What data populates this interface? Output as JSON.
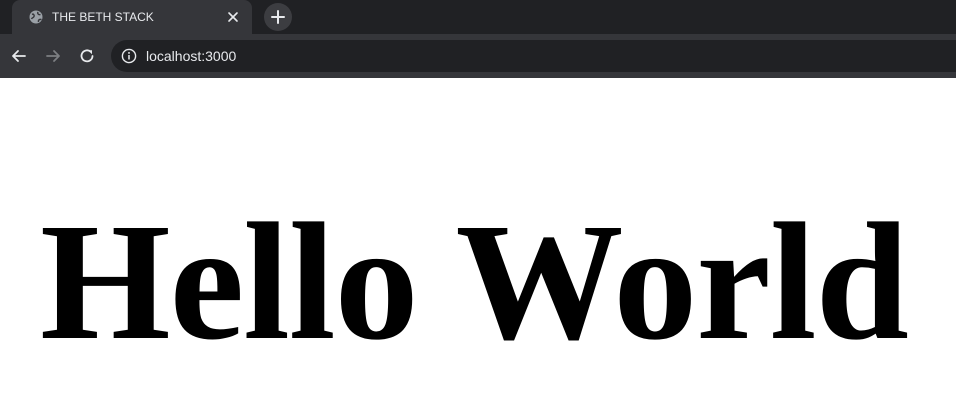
{
  "browser": {
    "tab": {
      "title": "THE BETH STACK",
      "favicon": "globe-icon"
    },
    "address_bar": {
      "url": "localhost:3000",
      "icon": "info-icon"
    },
    "colors": {
      "tabstrip": "#202124",
      "active_tab": "#35363a",
      "toolbar": "#35363a",
      "omnibox": "#202124",
      "text": "#e8eaed",
      "disabled_icon": "#7d7f82"
    }
  },
  "page": {
    "heading": "Hello World",
    "background": "#ffffff"
  }
}
